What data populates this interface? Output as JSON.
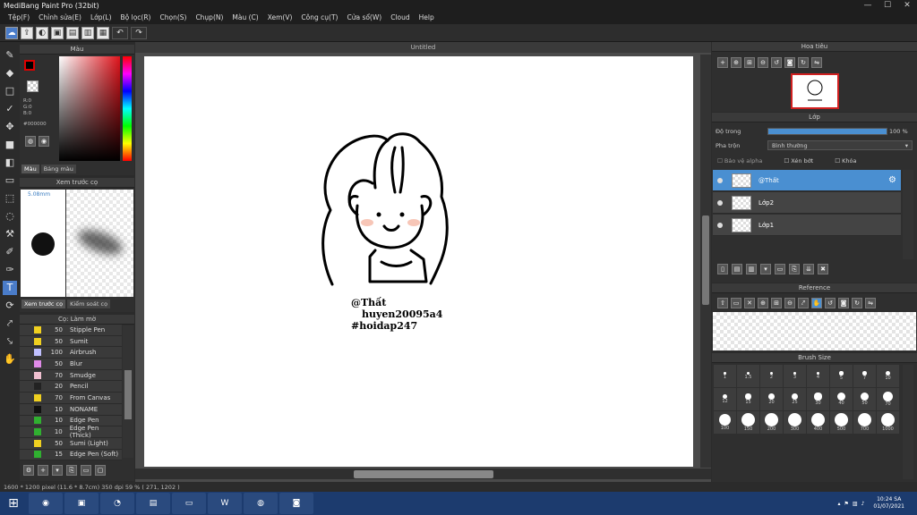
{
  "window": {
    "title": "MediBang Paint Pro (32bit)",
    "minimize": "—",
    "maximize": "☐",
    "close": "✕"
  },
  "menu": [
    "Tệp(F)",
    "Chỉnh sửa(E)",
    "Lớp(L)",
    "Bộ lọc(R)",
    "Chọn(S)",
    "Chụp(N)",
    "Màu (C)",
    "Xem(V)",
    "Công cụ(T)",
    "Cửa sổ(W)",
    "Cloud",
    "Help"
  ],
  "color_panel": {
    "title": "Màu",
    "r": "R:0",
    "g": "G:0",
    "b": "B:0",
    "hex": "#000000",
    "tabs": [
      "Màu",
      "Bảng màu"
    ],
    "foreground": "#000000",
    "accent": "#e0141c"
  },
  "brush_preview": {
    "title": "Xem trước cọ",
    "size": "5.08mm",
    "tabs": [
      "Xem trước cọ",
      "Kiểm soát cọ"
    ]
  },
  "brush_list": {
    "title": "Cọ: Làm mờ",
    "items": [
      {
        "size": "50",
        "name": "Stipple Pen",
        "color": "#f0d020"
      },
      {
        "size": "50",
        "name": "Sumit",
        "color": "#f0d020"
      },
      {
        "size": "100",
        "name": "Airbrush",
        "color": "#c0c0ff"
      },
      {
        "size": "50",
        "name": "Blur",
        "color": "#e08ae8"
      },
      {
        "size": "70",
        "name": "Smudge",
        "color": "#f0c0d0"
      },
      {
        "size": "20",
        "name": "Pencil",
        "color": "#222222"
      },
      {
        "size": "70",
        "name": "From Canvas",
        "color": "#f0d020"
      },
      {
        "size": "10",
        "name": "NONAME",
        "color": "#111111"
      },
      {
        "size": "10",
        "name": "Edge Pen",
        "color": "#30b030"
      },
      {
        "size": "10",
        "name": "Edge Pen (Thick)",
        "color": "#30b030"
      },
      {
        "size": "50",
        "name": "Sumi (Light)",
        "color": "#f0d020"
      },
      {
        "size": "15",
        "name": "Edge Pen (Soft)",
        "color": "#30b030"
      }
    ]
  },
  "document": {
    "tab": "Untitled",
    "signature_line1": "@Thất",
    "signature_line2": "huyen20095a4",
    "signature_line3": "#hoidap247"
  },
  "navigator": {
    "title": "Hoa tiêu"
  },
  "layers": {
    "title": "Lớp",
    "opacity_label": "Độ trong",
    "opacity_value": "100 %",
    "opacity_fraction": 1.0,
    "blend_label": "Pha trộn",
    "blend_value": "Bình thường",
    "alpha_protect": "Bảo vệ alpha",
    "clipping": "Xén bớt",
    "lock": "Khóa",
    "items": [
      {
        "name": "@Thất",
        "selected": true
      },
      {
        "name": "Lớp2",
        "selected": false
      },
      {
        "name": "Lớp1",
        "selected": false
      }
    ]
  },
  "reference": {
    "title": "Reference"
  },
  "brush_size": {
    "title": "Brush Size",
    "sizes": [
      "1",
      "1.5",
      "2",
      "3",
      "4",
      "5",
      "7",
      "10",
      "12",
      "15",
      "20",
      "25",
      "30",
      "40",
      "50",
      "70",
      "100",
      "150",
      "200",
      "300",
      "400",
      "500",
      "700",
      "1000"
    ]
  },
  "status": {
    "text": "1600 * 1200 pixel   (11.6 * 8.7cm)   350 dpi   59 %   ( 271, 1202 )"
  },
  "taskbar": {
    "time": "10:24 SA",
    "date": "01/07/2021"
  }
}
